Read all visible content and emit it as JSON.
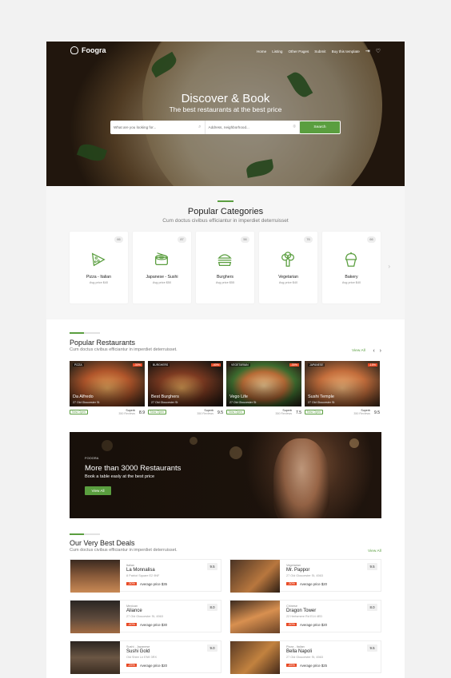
{
  "brand": {
    "name": "Foogra"
  },
  "nav": {
    "items": [
      "Home",
      "Listing",
      "Other Pages",
      "Submit",
      "Buy this template"
    ]
  },
  "hero": {
    "title": "Discover & Book",
    "subtitle": "The best restaurants at the best price",
    "search_what_placeholder": "What are you looking for...",
    "search_where_placeholder": "Address, neighborhood...",
    "search_button": "Search"
  },
  "categories": {
    "title": "Popular Categories",
    "subtitle": "Cum doctus civibus efficiantur in imperdiet deterruisset",
    "items": [
      {
        "count": "66",
        "name": "Pizza - Italian",
        "price": "Avg price $40",
        "icon": "pizza-icon"
      },
      {
        "count": "87",
        "name": "Japanese - Sushi",
        "price": "Avg price $50",
        "icon": "sushi-icon"
      },
      {
        "count": "56",
        "name": "Burghers",
        "price": "Avg price $55",
        "icon": "burger-icon"
      },
      {
        "count": "76",
        "name": "Vegetarian",
        "price": "Avg price $40",
        "icon": "broccoli-icon"
      },
      {
        "count": "66",
        "name": "Bakery",
        "price": "Avg price $40",
        "icon": "cupcake-icon"
      }
    ]
  },
  "popular": {
    "title": "Popular Restaurants",
    "subtitle": "Cum doctus civibus efficiantur in imperdiet deterruisset.",
    "view_all": "View All",
    "items": [
      {
        "tag": "PIZZA",
        "discount": "-30%",
        "name": "Da Alfredo",
        "address": "27 Old Gloucester St",
        "status": "Now Open",
        "rating_label": "Superb",
        "reviews": "350 Reviews",
        "score": "8.9"
      },
      {
        "tag": "BURGHERS",
        "discount": "-40%",
        "name": "Best Burghers",
        "address": "27 Old Gloucester St",
        "status": "Now Open",
        "rating_label": "Superb",
        "reviews": "350 Reviews",
        "score": "9.5"
      },
      {
        "tag": "VEGETARIAN",
        "discount": "-30%",
        "name": "Vego Life",
        "address": "27 Old Gloucester St",
        "status": "Now Open",
        "rating_label": "Superb",
        "reviews": "350 Reviews",
        "score": "7.5"
      },
      {
        "tag": "JAPANESE",
        "discount": "-15%",
        "name": "Sushi Temple",
        "address": "27 Old Gloucester St",
        "status": "Now Open",
        "rating_label": "Superb",
        "reviews": "350 Reviews",
        "score": "9.5"
      }
    ]
  },
  "banner": {
    "brand": "FOOGRA",
    "title": "More than 3000 Restaurants",
    "subtitle": "Book a table easly at the best price",
    "button": "View All"
  },
  "deals": {
    "title": "Our Very Best Deals",
    "subtitle": "Cum doctus civibus efficiantur in imperdiet deterruisset.",
    "view_all": "View All",
    "items": [
      {
        "cuisine": "Italian",
        "name": "La Monnalisa",
        "address": "8 Patriot Square E2 9NF",
        "discount": "-30%",
        "avg": "Average price $35",
        "score": "9.5"
      },
      {
        "cuisine": "Vegetarian",
        "name": "Mr. Pappor",
        "address": "27 Old Gloucester St, 4563",
        "discount": "-30%",
        "avg": "Average price $20",
        "score": "9.5"
      },
      {
        "cuisine": "Mexican",
        "name": "Aliance",
        "address": "27 Old Gloucester St, 4563",
        "discount": "-40%",
        "avg": "Average price $30",
        "score": "8.0"
      },
      {
        "cuisine": "Chinese",
        "name": "Dragon Tower",
        "address": "22 Hertsmere Rd E14 4ED",
        "discount": "-50%",
        "avg": "Average price $20",
        "score": "8.0"
      },
      {
        "cuisine": "Sushi - Japanese",
        "name": "Sushi Gold",
        "address": "Old Shire Ln EN9 3RX",
        "discount": "-25%",
        "avg": "Average price $20",
        "score": "9.0"
      },
      {
        "cuisine": "Pizza - Italian",
        "name": "Bella Napoli",
        "address": "27 Old Gloucester St, 4563",
        "discount": "-45%",
        "avg": "Average price $25",
        "score": "9.5"
      }
    ]
  },
  "colors": {
    "accent": "#5a9e3f",
    "discount": "#e84a25"
  }
}
